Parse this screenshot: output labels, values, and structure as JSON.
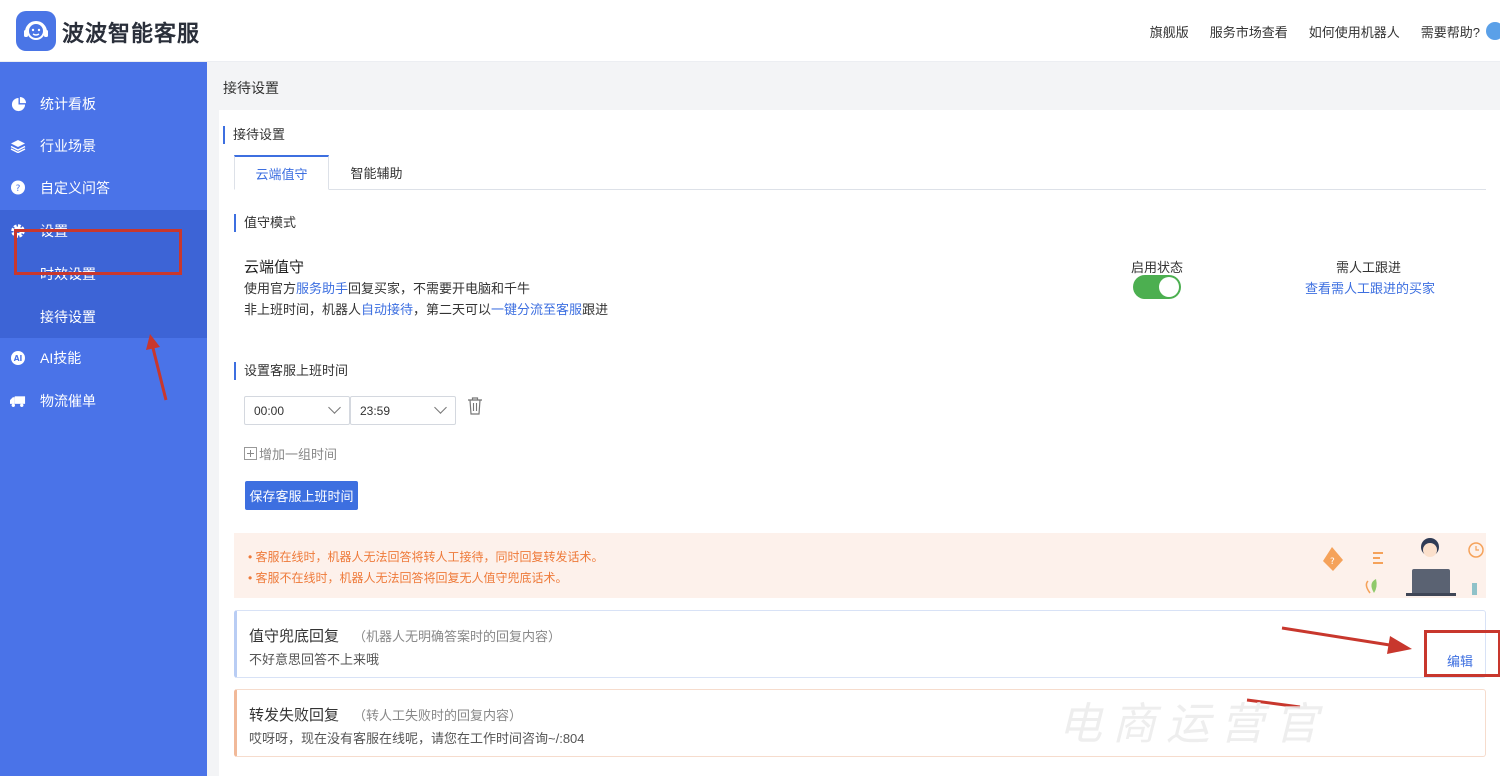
{
  "app": {
    "brand": "波波智能客服"
  },
  "topnav": {
    "items": [
      "旗舰版",
      "服务市场查看",
      "如何使用机器人",
      "需要帮助?"
    ]
  },
  "sidebar": {
    "items": [
      {
        "label": "统计看板",
        "icon": "pie-chart-icon"
      },
      {
        "label": "行业场景",
        "icon": "layers-icon"
      },
      {
        "label": "自定义问答",
        "icon": "question-icon"
      },
      {
        "label": "设置",
        "icon": "gear-icon"
      },
      {
        "label": "AI技能",
        "icon": "ai-icon"
      },
      {
        "label": "物流催单",
        "icon": "truck-icon"
      }
    ],
    "subitems": [
      "时效设置",
      "接待设置"
    ]
  },
  "page": {
    "title": "接待设置"
  },
  "panel": {
    "section_title": "接待设置",
    "tabs": [
      "云端值守",
      "智能辅助"
    ],
    "mode": {
      "section": "值守模式",
      "title": "云端值守",
      "line1": {
        "a": "使用官方",
        "link": "服务助手",
        "b": "回复买家，不需要开电脑和千牛"
      },
      "line2": {
        "a": "非上班时间，机器人",
        "link1": "自动接待",
        "b": "，第二天可以",
        "link2": "一键分流至客服",
        "c": "跟进"
      },
      "status_label": "启用状态",
      "enabled": true,
      "followup_label": "需人工跟进",
      "followup_link": "查看需人工跟进的买家"
    },
    "worktime": {
      "section": "设置客服上班时间",
      "start": "00:00",
      "end": "23:59",
      "add_label": "增加一组时间",
      "save_label": "保存客服上班时间"
    },
    "notice": [
      "• 客服在线时，机器人无法回答将转人工接待，同时回复转发话术。",
      "• 客服不在线时，机器人无法回答将回复无人值守兜底话术。"
    ],
    "replies": [
      {
        "title": "值守兜底回复",
        "hint": "（机器人无明确答案时的回复内容）",
        "text": "不好意思回答不上来哦",
        "edit": "编辑"
      },
      {
        "title": "转发失败回复",
        "hint": "（转人工失败时的回复内容）",
        "text": "哎呀呀，现在没有客服在线呢，请您在工作时间咨询~/:804"
      }
    ]
  },
  "watermark": "电商运营官",
  "colors": {
    "sidebar": "#4a73e8",
    "accent": "#3d6fe0",
    "annotation": "#c8372d",
    "toggle_on": "#4caf50"
  }
}
